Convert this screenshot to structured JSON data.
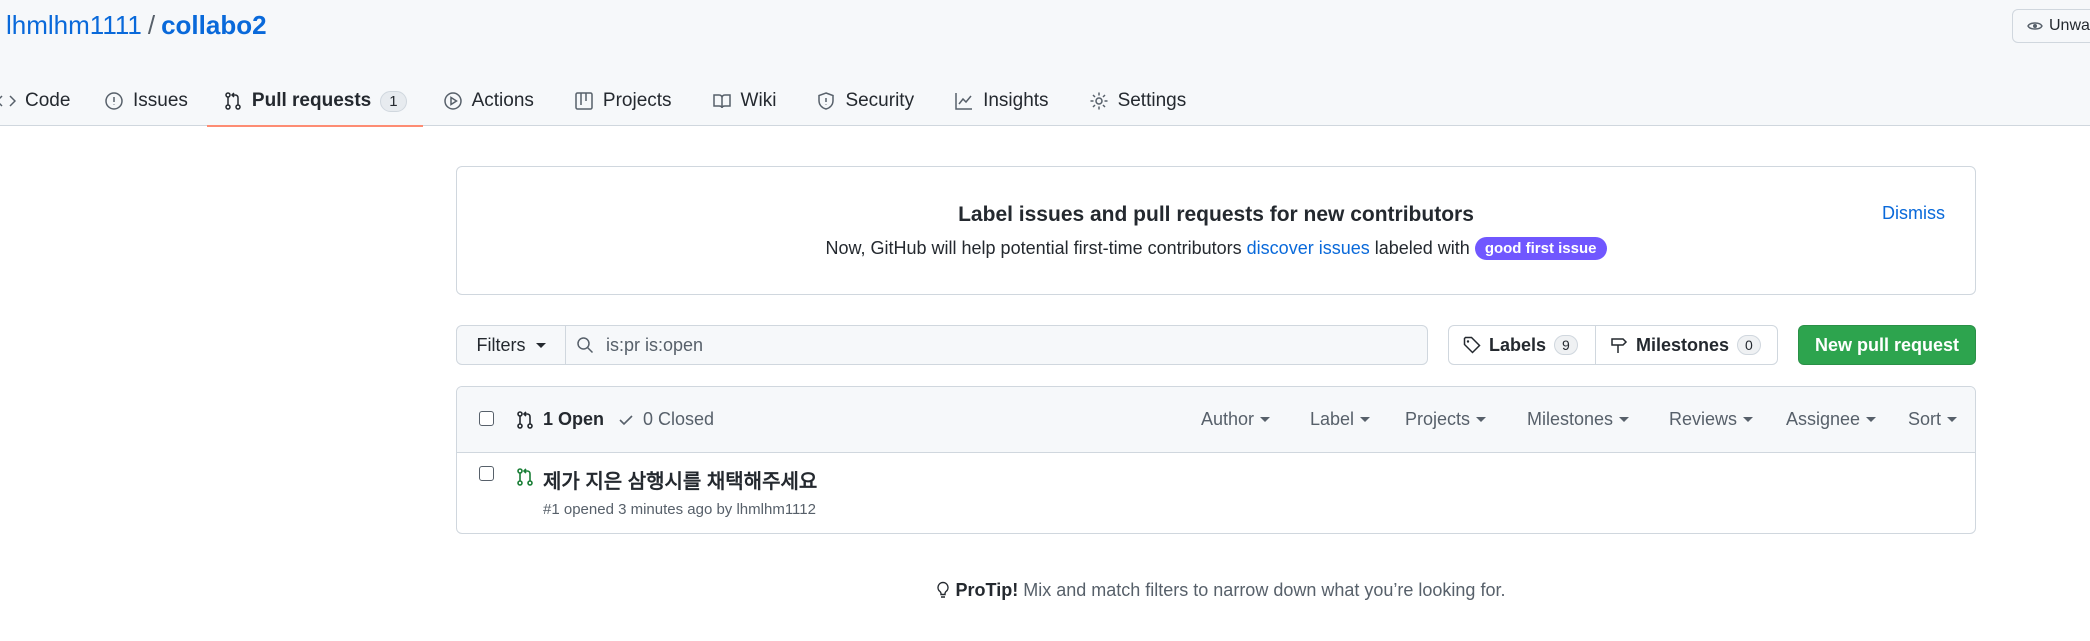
{
  "header": {
    "owner": "lhmlhm1111",
    "separator": "/",
    "repo": "collabo2",
    "watch_label": "Unwa"
  },
  "tabs": [
    {
      "label": "Code",
      "icon": "code-icon"
    },
    {
      "label": "Issues",
      "icon": "issue-opened-icon"
    },
    {
      "label": "Pull requests",
      "icon": "git-pull-request-icon",
      "counter": "1",
      "selected": true
    },
    {
      "label": "Actions",
      "icon": "play-icon"
    },
    {
      "label": "Projects",
      "icon": "table-icon"
    },
    {
      "label": "Wiki",
      "icon": "book-icon"
    },
    {
      "label": "Security",
      "icon": "shield-icon"
    },
    {
      "label": "Insights",
      "icon": "graph-icon"
    },
    {
      "label": "Settings",
      "icon": "gear-icon"
    }
  ],
  "banner": {
    "title": "Label issues and pull requests for new contributors",
    "text_before": "Now, GitHub will help potential first-time contributors",
    "link": "discover issues",
    "text_after": "labeled with",
    "label": "good first issue",
    "label_color": "#7057ff",
    "dismiss": "Dismiss"
  },
  "filters": {
    "button": "Filters",
    "search_value": "is:pr is:open"
  },
  "labels_btn": {
    "label": "Labels",
    "count": "9"
  },
  "milestones_btn": {
    "label": "Milestones",
    "count": "0"
  },
  "new_pr": {
    "label": "New pull request",
    "color": "#2da44e"
  },
  "list_header": {
    "open": "1 Open",
    "closed": "0 Closed",
    "selectors": [
      "Author",
      "Label",
      "Projects",
      "Milestones",
      "Reviews",
      "Assignee",
      "Sort"
    ]
  },
  "pull_requests": [
    {
      "title": "제가 지은 삼행시를 채택해주세요",
      "meta": "#1 opened 3 minutes ago by lhmlhm1112"
    }
  ],
  "protip": {
    "strong": "ProTip!",
    "text": "Mix and match filters to narrow down what you’re looking for."
  }
}
